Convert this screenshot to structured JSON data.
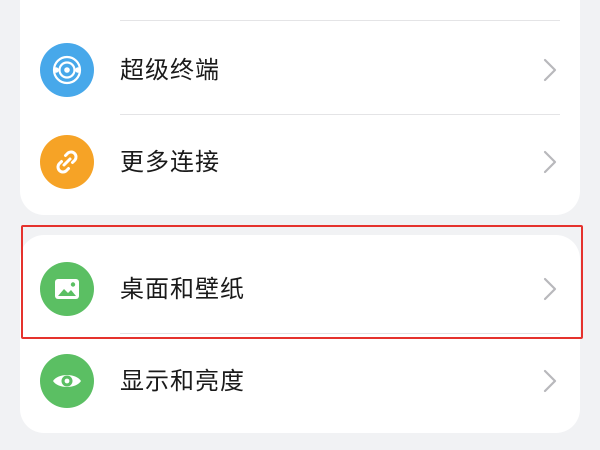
{
  "settings": {
    "group_top": {
      "items": [
        {
          "label": "超级终端",
          "icon": "super-device-icon",
          "color": "#47a8ea"
        },
        {
          "label": "更多连接",
          "icon": "link-icon",
          "color": "#f6a326"
        }
      ],
      "partial_icon_color": "#5bbf63"
    },
    "group_bottom": {
      "items": [
        {
          "label": "桌面和壁纸",
          "icon": "image-icon",
          "color": "#5bbf63"
        },
        {
          "label": "显示和亮度",
          "icon": "eye-icon",
          "color": "#5bbf63"
        }
      ]
    }
  },
  "highlight": {
    "color": "#e5322d"
  }
}
